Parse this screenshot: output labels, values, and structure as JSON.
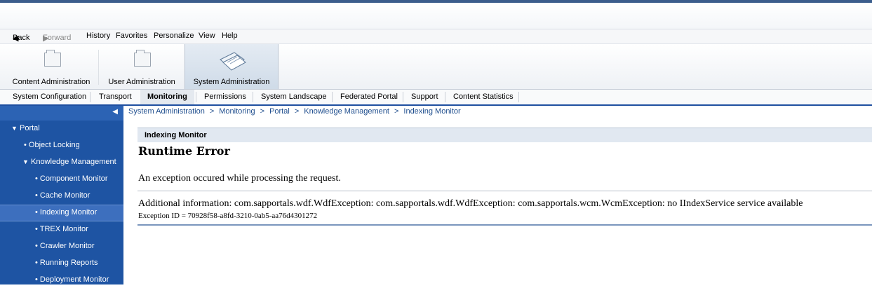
{
  "toolbar": {
    "back": "Back",
    "forward": "Forward",
    "history": "History",
    "favorites": "Favorites",
    "personalize": "Personalize",
    "view": "View",
    "help": "Help"
  },
  "roles": [
    {
      "label": "Content Administration",
      "icon": "folder-icon"
    },
    {
      "label": "User Administration",
      "icon": "folder-icon"
    },
    {
      "label": "System Administration",
      "icon": "system-admin-icon",
      "active": true
    }
  ],
  "detail_nav": [
    "System Configuration",
    "Transport",
    "Monitoring",
    "Permissions",
    "System Landscape",
    "Federated Portal",
    "Support",
    "Content Statistics"
  ],
  "breadcrumb": [
    "System Administration",
    "Monitoring",
    "Portal",
    "Knowledge Management",
    "Indexing Monitor"
  ],
  "breadcrumb_sep": ">",
  "sidebar": {
    "collapse_glyph": "◀",
    "items": [
      {
        "label": "Portal",
        "level": 0,
        "expanded": true
      },
      {
        "label": "Object Locking",
        "level": 1
      },
      {
        "label": "Knowledge Management",
        "level": 1,
        "expanded": true
      },
      {
        "label": "Component Monitor",
        "level": 2
      },
      {
        "label": "Cache Monitor",
        "level": 2
      },
      {
        "label": "Indexing Monitor",
        "level": 2,
        "selected": true
      },
      {
        "label": "TREX Monitor",
        "level": 2
      },
      {
        "label": "Crawler Monitor",
        "level": 2
      },
      {
        "label": "Running Reports",
        "level": 2
      },
      {
        "label": "Deployment Monitor",
        "level": 2
      }
    ]
  },
  "panel": {
    "title": "Indexing Monitor",
    "heading": "Runtime Error",
    "message": "An exception occured while processing the request.",
    "additional": "Additional information: com.sapportals.wdf.WdfException: com.sapportals.wdf.WdfException: com.sapportals.wcm.WcmException: no IIndexService service available",
    "exception_id": "Exception ID = 70928f58-a8fd-3210-0ab5-aa76d4301272"
  },
  "colors": {
    "sidebar_bg": "#1e54a3",
    "sidebar_selected": "#3d6fbe",
    "nav_underline": "#1f4fa0",
    "link": "#1e4d8d"
  }
}
